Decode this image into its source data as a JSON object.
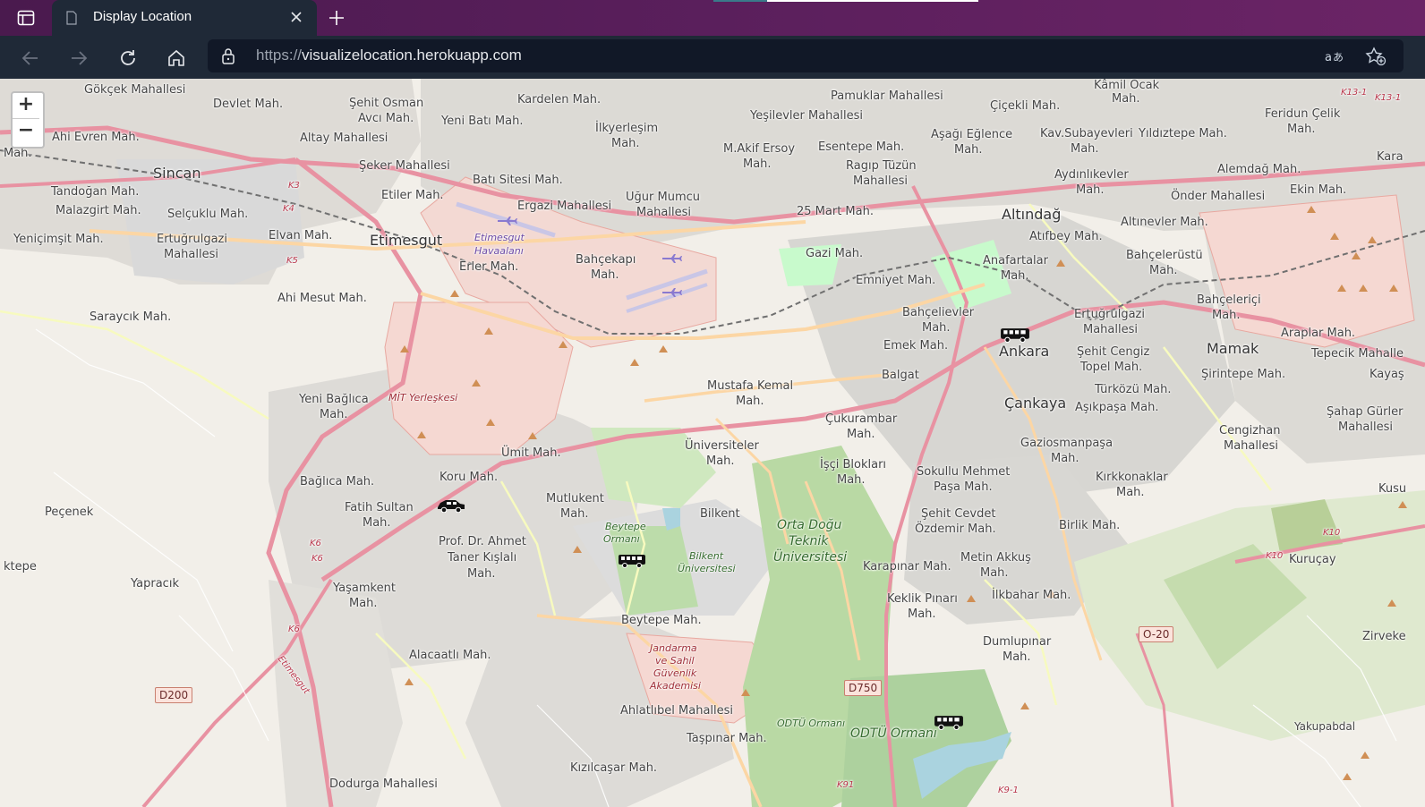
{
  "browser": {
    "tab": {
      "title": "Display Location"
    },
    "address_bar": {
      "url_protocol": "https://",
      "url_host": "visualizelocation.herokuapp.com"
    },
    "colors": {
      "tabbar": "#5a1f5c",
      "toolbar": "#1f2937",
      "address_bg": "#111827"
    },
    "icons": [
      "tab-actions-icon",
      "page-icon",
      "close-icon",
      "plus-icon",
      "back-icon",
      "forward-icon",
      "refresh-icon",
      "home-icon",
      "lock-icon",
      "read-aloud-icon",
      "favorite-add-icon"
    ]
  },
  "map": {
    "zoom_in_label": "+",
    "zoom_out_label": "−",
    "places": {
      "gokcek": "Gökçek Mahallesi",
      "devlet": "Devlet Mah.",
      "sehit_osman_1": "Şehit Osman",
      "sehit_osman_2": "Avcı Mah.",
      "kardelen": "Kardelen Mah.",
      "yeni_bati": "Yeni Batı Mah.",
      "pamuklar": "Pamuklar Mahallesi",
      "yesilevler": "Yeşilevler Mahallesi",
      "cicekli": "Çiçekli Mah.",
      "kamil_ocak_1": "Kâmil Ocak",
      "kamil_ocak_2": "Mah.",
      "feridun_1": "Feridun Çelik",
      "feridun_2": "Mah.",
      "ahi_evren": "Ahi Evren Mah.",
      "altay": "Altay Mahallesi",
      "ilkyerlesim_1": "İlkyerleşim",
      "ilkyerlesim_2": "Mah.",
      "makif_1": "M.Akif Ersoy",
      "makif_2": "Mah.",
      "esentepe": "Esentepe Mah.",
      "asagi_1": "Aşağı Eğlence",
      "asagi_2": "Mah.",
      "kavsubay_1": "Kav.Subayevleri",
      "kavsubay_2": "Mah.",
      "yildiztepe": "Yıldıztepe Mah.",
      "kara": "Kara",
      "mah_left": "Mah.",
      "seker": "Şeker Mahallesi",
      "ragip_1": "Ragıp Tüzün",
      "ragip_2": "Mahallesi",
      "aydinlikevler_1": "Aydınlıkevler",
      "aydinlikevler_2": "Mah.",
      "alemdag": "Alemdağ Mah.",
      "sincan": "Sincan",
      "bati_sitesi": "Batı Sitesi Mah.",
      "ugur_1": "Uğur Mumcu",
      "ugur_2": "Mahallesi",
      "onder": "Önder Mahallesi",
      "ekin": "Ekin Mah.",
      "tandogan": "Tandoğan Mah.",
      "etiler": "Etiler Mah.",
      "ergazi": "Ergazi Mahallesi",
      "mart25": "25 Mart Mah.",
      "altindag": "Altındağ",
      "altinevler": "Altınevler Mah.",
      "malazgirt": "Malazgirt Mah.",
      "selcuklu": "Selçuklu Mah.",
      "etimesgut_hav_1": "Etimesgut",
      "etimesgut_hav_2": "Havaalanı",
      "atifbey": "Atıfbey Mah.",
      "yenicimsit": "Yeniçimşit Mah.",
      "ertugrul_w_1": "Ertuğrulgazi",
      "ertugrul_w_2": "Mahallesi",
      "elvan": "Elvan Mah.",
      "etimesgut": "Etimesgut",
      "bahcekapi_1": "Bahçekapı",
      "bahcekapi_2": "Mah.",
      "gazi": "Gazi Mah.",
      "anafartalar_1": "Anafartalar",
      "anafartalar_2": "Mah.",
      "bahcelerustu_1": "Bahçelerüstü",
      "bahcelerustu_2": "Mah.",
      "erler": "Erler Mah.",
      "emniyet": "Emniyet Mah.",
      "ahi_mesut": "Ahi Mesut Mah.",
      "bahcelievler_1": "Bahçelievler",
      "bahcelievler_2": "Mah.",
      "bahcelerici_1": "Bahçeleriçi",
      "bahcelerici_2": "Mah.",
      "ertugrul_e_1": "Ertuğrulgazi",
      "ertugrul_e_2": "Mahallesi",
      "saraycik": "Saraycık Mah.",
      "araplar": "Araplar Mah.",
      "emek": "Emek Mah.",
      "ankara": "Ankara",
      "sehit_cengiz_1": "Şehit Cengiz",
      "sehit_cengiz_2": "Topel Mah.",
      "mamak": "Mamak",
      "tepecik": "Tepecik Mahalle",
      "balgat": "Balgat",
      "sirintepe": "Şirintepe Mah.",
      "kayas": "Kayaş",
      "mustafa_kemal_1": "Mustafa Kemal",
      "mustafa_kemal_2": "Mah.",
      "turkozu": "Türközü Mah.",
      "yeni_baglica_1": "Yeni Bağlıca",
      "yeni_baglica_2": "Mah.",
      "mit": "MİT Yerleşkesi",
      "cankaya": "Çankaya",
      "asikpasa": "Aşıkpaşa Mah.",
      "sahap_1": "Şahap Gürler",
      "sahap_2": "Mahallesi",
      "cukurambar_1": "Çukurambar",
      "cukurambar_2": "Mah.",
      "gaziosmanpasa_1": "Gaziosmanpaşa",
      "gaziosmanpasa_2": "Mah.",
      "cengizhan_1": "Cengizhan",
      "cengizhan_2": "Mahallesi",
      "universiteler_1": "Üniversiteler",
      "universiteler_2": "Mah.",
      "umit": "Ümit Mah.",
      "isci_1": "İşçi Blokları",
      "isci_2": "Mah.",
      "sokullu_1": "Sokullu Mehmet",
      "sokullu_2": "Paşa Mah.",
      "kirkkonaklar_1": "Kırkkonaklar",
      "kirkkonaklar_2": "Mah.",
      "koru": "Koru Mah.",
      "baglica": "Bağlıca Mah.",
      "kusu": "Kusu",
      "mutlukent_1": "Mutlukent",
      "mutlukent_2": "Mah.",
      "bilkent": "Bilkent",
      "sehit_cevdet_1": "Şehit Cevdet",
      "sehit_cevdet_2": "Özdemir Mah.",
      "pecenek": "Peçenek",
      "fatih_1": "Fatih Sultan",
      "fatih_2": "Mah.",
      "beytepe_orm_1": "Beytepe",
      "beytepe_orm_2": "Ormanı",
      "odtu_orta_1": "Orta Doğu",
      "odtu_orta_2": "Teknik",
      "odtu_orta_3": "Üniversitesi",
      "birlik": "Birlik Mah.",
      "prof_1": "Prof. Dr. Ahmet",
      "prof_2": "Taner Kışlalı",
      "prof_3": "Mah.",
      "bilkent_uni_1": "Bilkent",
      "bilkent_uni_2": "Üniversitesi",
      "karapinar": "Karapınar Mah.",
      "metin_1": "Metin Akkuş",
      "metin_2": "Mah.",
      "kuruçay": "Kuruçay",
      "ktepe": "ktepe",
      "yapracik": "Yapracık",
      "yasamkent_1": "Yaşamkent",
      "yasamkent_2": "Mah.",
      "keklik_1": "Keklik Pınarı",
      "keklik_2": "Mah.",
      "ilkbahar": "İlkbahar Mah.",
      "beytepe": "Beytepe Mah.",
      "zirveke": "Zirveke",
      "dumlupinar_1": "Dumlupınar",
      "dumlupinar_2": "Mah.",
      "jandarma_1": "Jandarma",
      "jandarma_2": "ve Sahil",
      "jandarma_3": "Güvenlik",
      "jandarma_4": "Akademisi",
      "alacaatli": "Alacaatlı Mah.",
      "etimesgut_road": "Etimesgut",
      "ahlatlibel": "Ahlatlıbel Mahallesi",
      "odtu_ormani_sm": "ODTÜ Ormanı",
      "odtu_ormani": "ODTÜ Ormanı",
      "yakupabdal": "Yakupabdal",
      "taspinar": "Taşpınar Mah.",
      "kizilcasar": "Kızılcaşar Mah.",
      "dodurga": "Dodurga Mahallesi"
    },
    "road_shields": {
      "d200": "D200",
      "d750": "D750",
      "o20": "O-20"
    },
    "road_refs": {
      "k3": "K3",
      "k4": "K4",
      "k5": "K5",
      "k6a": "K6",
      "k6b": "K6",
      "k6c": "K6",
      "k10a": "K10",
      "k10b": "K10",
      "k13a": "K13-1",
      "k13b": "K13-1",
      "k91": "K91",
      "k91b": "K9-1"
    },
    "markers": [
      "car-icon",
      "bus-icon",
      "bus-icon",
      "bus-icon"
    ],
    "colors": {
      "land": "#f2efe9",
      "residential": "#dcdcdc",
      "military": "#f5d6d0",
      "forest": "#add19e",
      "park": "#c8facc",
      "motorway": "#e892a2",
      "primary": "#fcd6a4",
      "secondary": "#f7fabf",
      "water": "#aad3df"
    }
  }
}
